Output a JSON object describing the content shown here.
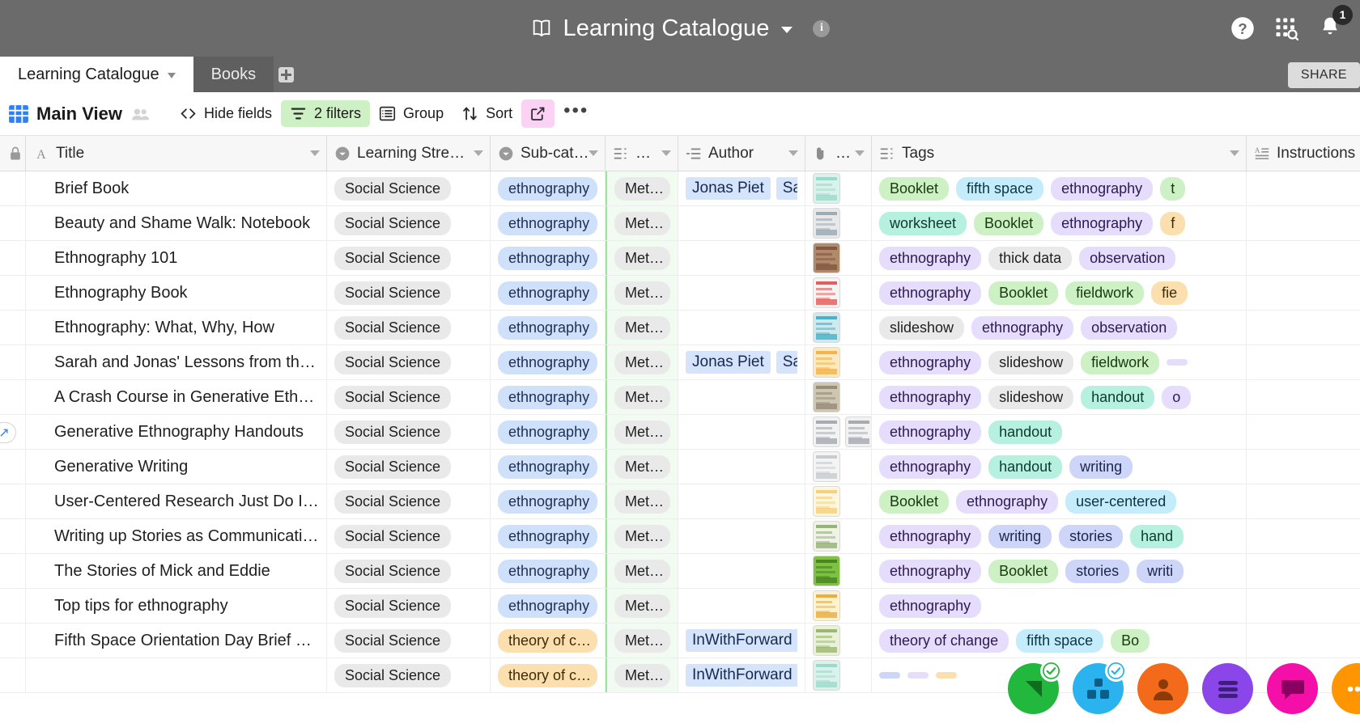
{
  "topbar": {
    "title": "Learning Catalogue",
    "book_icon": "book-icon",
    "dropdown_caret": "chevron-down-icon",
    "info_icon": "info-icon",
    "help_icon": "help-icon",
    "apps_icon": "apps-search-icon",
    "bell_icon": "bell-icon",
    "notification_count": "1"
  },
  "tabs": {
    "items": [
      {
        "label": "Learning Catalogue",
        "active": true,
        "has_caret": true
      },
      {
        "label": "Books",
        "active": false,
        "has_caret": false
      }
    ],
    "add_label": "add-table",
    "share_label": "SHARE"
  },
  "toolbar": {
    "view_icon": "grid-view-icon",
    "view_name": "Main View",
    "collaborators_icon": "collaborators-icon",
    "hide_fields": "Hide fields",
    "filters": "2 filters",
    "group": "Group",
    "sort": "Sort",
    "share_view_icon": "share-view-icon",
    "more": "•••",
    "filters_color": "#cdf0c4",
    "share_view_color": "#fbd2f3"
  },
  "grid": {
    "columns": [
      {
        "key": "gutter",
        "label": "",
        "icon": "lock-icon",
        "caret": false
      },
      {
        "key": "title",
        "label": "Title",
        "icon": "text-field-icon",
        "caret": true
      },
      {
        "key": "stream",
        "label": "Learning Stre…",
        "icon": "single-select-icon",
        "caret": true
      },
      {
        "key": "sub",
        "label": "Sub-cat…",
        "icon": "single-select-icon",
        "caret": true
      },
      {
        "key": "met",
        "label": "…",
        "icon": "multi-select-icon",
        "caret": true
      },
      {
        "key": "author",
        "label": "Author",
        "icon": "link-record-icon",
        "caret": true
      },
      {
        "key": "att",
        "label": "…",
        "icon": "attachment-icon",
        "caret": true
      },
      {
        "key": "tags",
        "label": "Tags",
        "icon": "multi-select-icon",
        "caret": true
      },
      {
        "key": "instr",
        "label": "Instructions",
        "icon": "long-text-icon",
        "caret": false
      }
    ],
    "rows": [
      {
        "title": "Brief Book",
        "stream": "Social Science",
        "sub": "ethnography",
        "sub_color": "blue",
        "met": "Met…",
        "authors": [
          "Jonas Piet",
          "Sara"
        ],
        "tags": [
          {
            "t": "Booklet",
            "c": "green"
          },
          {
            "t": "fifth space",
            "c": "cyan"
          },
          {
            "t": "ethnography",
            "c": "purple"
          },
          {
            "t": "t",
            "c": "green"
          }
        ]
      },
      {
        "title": "Beauty and Shame Walk: Notebook",
        "stream": "Social Science",
        "sub": "ethnography",
        "sub_color": "blue",
        "met": "Met…",
        "authors": [],
        "tags": [
          {
            "t": "worksheet",
            "c": "teal"
          },
          {
            "t": "Booklet",
            "c": "green"
          },
          {
            "t": "ethnography",
            "c": "purple"
          },
          {
            "t": "f",
            "c": "orange"
          }
        ]
      },
      {
        "title": "Ethnography 101",
        "stream": "Social Science",
        "sub": "ethnography",
        "sub_color": "blue",
        "met": "Met…",
        "authors": [],
        "tags": [
          {
            "t": "ethnography",
            "c": "purple"
          },
          {
            "t": "thick data",
            "c": "gray"
          },
          {
            "t": "observation",
            "c": "purple"
          }
        ]
      },
      {
        "title": "Ethnography Book",
        "stream": "Social Science",
        "sub": "ethnography",
        "sub_color": "blue",
        "met": "Met…",
        "authors": [],
        "tags": [
          {
            "t": "ethnography",
            "c": "purple"
          },
          {
            "t": "Booklet",
            "c": "green"
          },
          {
            "t": "fieldwork",
            "c": "green"
          },
          {
            "t": "fie",
            "c": "orange"
          }
        ]
      },
      {
        "title": "Ethnography: What, Why, How",
        "stream": "Social Science",
        "sub": "ethnography",
        "sub_color": "blue",
        "met": "Met…",
        "authors": [],
        "tags": [
          {
            "t": "slideshow",
            "c": "gray"
          },
          {
            "t": "ethnography",
            "c": "purple"
          },
          {
            "t": "observation",
            "c": "purple"
          }
        ]
      },
      {
        "title": "Sarah and Jonas' Lessons from their Fav…",
        "stream": "Social Science",
        "sub": "ethnography",
        "sub_color": "blue",
        "met": "Met…",
        "authors": [
          "Jonas Piet",
          "Sara"
        ],
        "tags": [
          {
            "t": "ethnography",
            "c": "purple"
          },
          {
            "t": "slideshow",
            "c": "gray"
          },
          {
            "t": "fieldwork",
            "c": "green"
          },
          {
            "t": "",
            "c": "purple"
          }
        ]
      },
      {
        "title": "A Crash Course in Generative Ethnography",
        "stream": "Social Science",
        "sub": "ethnography",
        "sub_color": "blue",
        "met": "Met…",
        "authors": [],
        "tags": [
          {
            "t": "ethnography",
            "c": "purple"
          },
          {
            "t": "slideshow",
            "c": "gray"
          },
          {
            "t": "handout",
            "c": "teal"
          },
          {
            "t": "o",
            "c": "purple"
          }
        ]
      },
      {
        "title": "Generative Ethnography Handouts",
        "expand": true,
        "stream": "Social Science",
        "sub": "ethnography",
        "sub_color": "blue",
        "met": "Met…",
        "authors": [],
        "tags": [
          {
            "t": "ethnography",
            "c": "purple"
          },
          {
            "t": "handout",
            "c": "teal"
          }
        ]
      },
      {
        "title": "Generative Writing",
        "stream": "Social Science",
        "sub": "ethnography",
        "sub_color": "blue",
        "met": "Met…",
        "authors": [],
        "tags": [
          {
            "t": "ethnography",
            "c": "purple"
          },
          {
            "t": "handout",
            "c": "teal"
          },
          {
            "t": "writing",
            "c": "lav"
          }
        ]
      },
      {
        "title": "User-Centered Research Just Do It Guide",
        "stream": "Social Science",
        "sub": "ethnography",
        "sub_color": "blue",
        "met": "Met…",
        "authors": [],
        "tags": [
          {
            "t": "Booklet",
            "c": "green"
          },
          {
            "t": "ethnography",
            "c": "purple"
          },
          {
            "t": "user-centered",
            "c": "cyan"
          }
        ]
      },
      {
        "title": "Writing up Stories as Communication De…",
        "stream": "Social Science",
        "sub": "ethnography",
        "sub_color": "blue",
        "met": "Met…",
        "authors": [],
        "tags": [
          {
            "t": "ethnography",
            "c": "purple"
          },
          {
            "t": "writing",
            "c": "lav"
          },
          {
            "t": "stories",
            "c": "lav"
          },
          {
            "t": "hand",
            "c": "teal"
          }
        ]
      },
      {
        "title": "The Stories of Mick and Eddie",
        "stream": "Social Science",
        "sub": "ethnography",
        "sub_color": "blue",
        "met": "Met…",
        "authors": [],
        "tags": [
          {
            "t": "ethnography",
            "c": "purple"
          },
          {
            "t": "Booklet",
            "c": "green"
          },
          {
            "t": "stories",
            "c": "lav"
          },
          {
            "t": "writi",
            "c": "lav"
          }
        ]
      },
      {
        "title": "Top tips for ethnography",
        "stream": "Social Science",
        "sub": "ethnography",
        "sub_color": "blue",
        "met": "Met…",
        "authors": [],
        "tags": [
          {
            "t": "ethnography",
            "c": "purple"
          }
        ]
      },
      {
        "title": "Fifth Space Orientation Day Brief Book",
        "stream": "Social Science",
        "sub": "theory of c…",
        "sub_color": "orange",
        "met": "Met…",
        "authors": [
          "InWithForward"
        ],
        "tags": [
          {
            "t": "theory of change",
            "c": "purple"
          },
          {
            "t": "fifth space",
            "c": "cyan"
          },
          {
            "t": "Bo",
            "c": "green"
          }
        ]
      },
      {
        "title": "",
        "stream": "Social Science",
        "sub": "theory of c…",
        "sub_color": "orange",
        "met": "Met…",
        "authors": [
          "InWithForward"
        ],
        "tags": [
          {
            "t": "",
            "c": "lav"
          },
          {
            "t": "",
            "c": "purple"
          },
          {
            "t": "",
            "c": "orange"
          }
        ]
      }
    ]
  },
  "dock": {
    "items": [
      {
        "name": "green-app-icon",
        "color": "#22b83d",
        "badge": "check",
        "badge_color": "#22b83d"
      },
      {
        "name": "blue-app-icon",
        "color": "#2bb3ef",
        "badge": "check",
        "badge_color": "#2bb3ef"
      },
      {
        "name": "orange-user-icon",
        "color": "#f36a1b",
        "badge": ""
      },
      {
        "name": "purple-menu-icon",
        "color": "#8a46e8",
        "badge": ""
      },
      {
        "name": "pink-chat-icon",
        "color": "#f50fa9",
        "badge": ""
      },
      {
        "name": "orange-more-icon",
        "color": "#ff9500",
        "badge": ""
      }
    ]
  }
}
